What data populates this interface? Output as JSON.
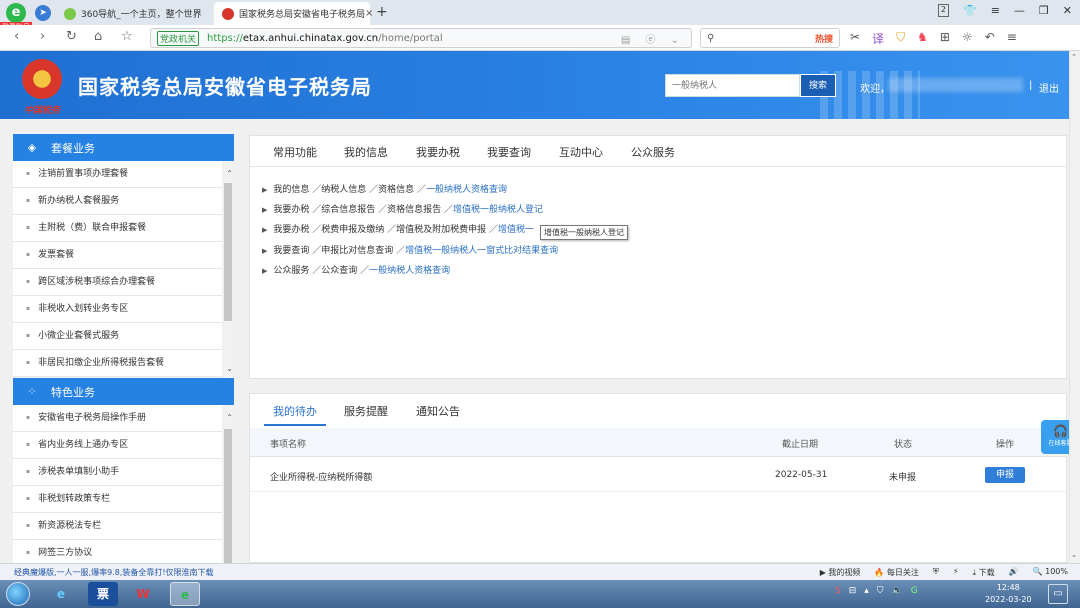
{
  "browser": {
    "login_badge": "登录账号",
    "tabs": [
      {
        "label": "360导航_一个主页，整个世界",
        "active": false
      },
      {
        "label": "国家税务总局安徽省电子税务局",
        "active": true
      }
    ],
    "tab_close": "×",
    "new_tab": "+",
    "address": {
      "gov_badge": "党政机关",
      "url_protocol": "https://",
      "url_host": "etax.anhui.chinatax.gov.cn",
      "url_path": "/home/portal"
    },
    "hot_label": "热搜",
    "window_page_count": "2"
  },
  "header": {
    "emblem_caption": "中国税务",
    "title": "国家税务总局安徽省电子税务局",
    "search": {
      "placeholder": "一般纳税人",
      "button": "搜索"
    },
    "welcome": "欢迎，",
    "divider": "|",
    "logout": "退出"
  },
  "sidebar": {
    "packages": {
      "title": "套餐业务",
      "items": [
        "注销前置事项办理套餐",
        "新办纳税人套餐服务",
        "主附税（费）联合申报套餐",
        "发票套餐",
        "跨区域涉税事项综合办理套餐",
        "非税收入划转业务专区",
        "小微企业套餐式服务",
        "非居民扣缴企业所得税报告套餐"
      ]
    },
    "features": {
      "title": "特色业务",
      "items": [
        "安徽省电子税务局操作手册",
        "省内业务线上通办专区",
        "涉税表单填制小助手",
        "非税划转政策专栏",
        "新资源税法专栏",
        "网签三方协议"
      ]
    }
  },
  "top_panel": {
    "tabs": [
      "常用功能",
      "我的信息",
      "我要办税",
      "我要查询",
      "互动中心",
      "公众服务"
    ],
    "breadcrumbs": [
      {
        "path": "我的信息 ／纳税人信息 ／资格信息 ／",
        "link": "一般纳税人资格查询"
      },
      {
        "path": "我要办税 ／综合信息报告 ／资格信息报告 ／",
        "link": "增值税一般纳税人登记"
      },
      {
        "path": "我要办税 ／税费申报及缴纳 ／增值税及附加税费申报 ／",
        "link": "增值税一"
      },
      {
        "path": "我要查询 ／申报比对信息查询 ／",
        "link": "增值税一般纳税人一窗式比对结果查询"
      },
      {
        "path": "公众服务 ／公众查询 ／",
        "link": "一般纳税人资格查询"
      }
    ],
    "tooltip": "增值税一般纳税人登记"
  },
  "bottom_panel": {
    "tabs": [
      "我的待办",
      "服务提醒",
      "通知公告"
    ],
    "columns": {
      "name": "事项名称",
      "deadline": "截止日期",
      "status": "状态",
      "action": "操作"
    },
    "rows": [
      {
        "name": "企业所得税-应纳税所得额",
        "deadline": "2022-05-31",
        "status": "未申报",
        "action": "申报"
      }
    ]
  },
  "online_service": "在线客服",
  "statusbar": {
    "news": "经典魔爆版,一人一服,爆率9.8,装备全靠打!仅限淮南下载",
    "items": [
      "我的视频",
      "每日关注",
      "下载",
      "100%"
    ]
  },
  "taskbar": {
    "time": "12:48",
    "date": "2022-03-20"
  }
}
